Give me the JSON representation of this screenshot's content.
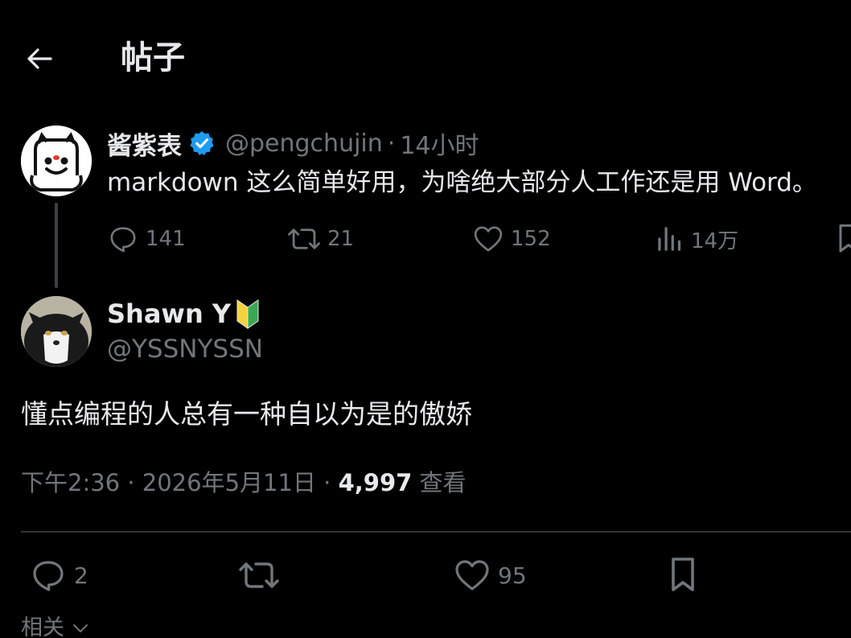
{
  "header": {
    "title": "帖子",
    "back_icon": "arrow-left-icon"
  },
  "parent_tweet": {
    "display_name": "酱紫表",
    "verified": true,
    "handle": "@pengchujin",
    "separator": "·",
    "time": "14小时",
    "text": "markdown 这么简单好用，为啥绝大部分人工作还是用 Word。",
    "avatar": "cartoon-face-avatar",
    "actions": {
      "replies": "141",
      "retweets": "21",
      "likes": "152",
      "views": "14万"
    }
  },
  "reply_tweet": {
    "display_name": "Shawn Y",
    "badge": "beginner-mark-icon",
    "handle": "@YSSNYSSN",
    "text": "懂点编程的人总有一种自以为是的傲娇",
    "avatar": "cat-photo-avatar",
    "timestamp": "下午2:36 · 2026年5月11日 · ",
    "view_count": "4,997",
    "view_label": " 查看",
    "actions": {
      "replies": "2",
      "likes": "95"
    }
  },
  "related": {
    "label": "相关"
  },
  "colors": {
    "background": "#000000",
    "text": "#e7e9ea",
    "muted": "#71767b",
    "verified_blue": "#1d9bf0",
    "divider": "#2f3336"
  }
}
